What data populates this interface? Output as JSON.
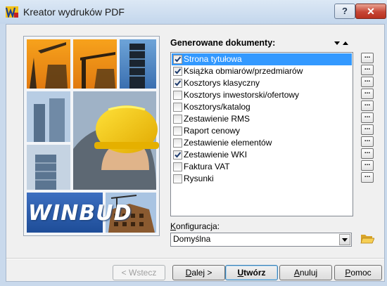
{
  "window": {
    "title": "Kreator wydruków PDF",
    "help_label": "?",
    "close_label": "✕"
  },
  "side_image": {
    "brand": "WINBUD"
  },
  "documents": {
    "header": "Generowane dokumenty:",
    "items": [
      {
        "label": "Strona tytułowa",
        "checked": true,
        "selected": true
      },
      {
        "label": "Książka obmiarów/przedmiarów",
        "checked": true,
        "selected": false
      },
      {
        "label": "Kosztorys klasyczny",
        "checked": true,
        "selected": false
      },
      {
        "label": "Kosztorys inwestorski/ofertowy",
        "checked": false,
        "selected": false
      },
      {
        "label": "Kosztorys/katalog",
        "checked": false,
        "selected": false
      },
      {
        "label": "Zestawienie RMS",
        "checked": false,
        "selected": false
      },
      {
        "label": "Raport cenowy",
        "checked": false,
        "selected": false
      },
      {
        "label": "Zestawienie elementów",
        "checked": false,
        "selected": false
      },
      {
        "label": "Zestawienie WKI",
        "checked": true,
        "selected": false
      },
      {
        "label": "Faktura VAT",
        "checked": false,
        "selected": false
      },
      {
        "label": "Rysunki",
        "checked": false,
        "selected": false
      }
    ],
    "more_label": "..."
  },
  "config": {
    "label_first": "K",
    "label_rest": "onfiguracja:",
    "value": "Domyślna"
  },
  "buttons": {
    "back": "< Wstecz",
    "next_u": "D",
    "next_rest": "alej >",
    "create_u": "U",
    "create_rest": "twórz",
    "cancel_u": "A",
    "cancel_rest": "nuluj",
    "help_u": "P",
    "help_rest": "omoc"
  },
  "colors": {
    "selection": "#3399ff",
    "titlebar": "#c9d9ec",
    "close": "#c64535"
  }
}
